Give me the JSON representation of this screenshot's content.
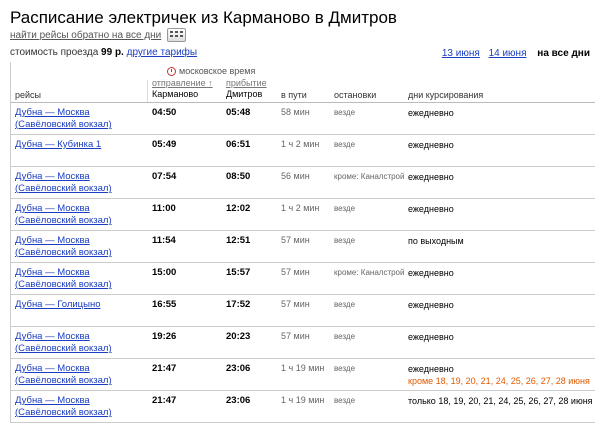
{
  "page": {
    "title": "Расписание электричек из Карманово в Дмитров",
    "reverse_link": "найти рейсы обратно на все дни",
    "price_prefix": "стоимость проезда",
    "price_value": "99 р.",
    "other_tariffs": "другие тарифы"
  },
  "date_nav": {
    "day1": "13 июня",
    "day2": "14 июня",
    "all_days": "на все дни"
  },
  "table": {
    "col_routes": "рейсы",
    "moscow_time": "московское время",
    "dep_label": "отправление ↑",
    "dep_station": "Карманово",
    "arr_label": "прибытие",
    "arr_station": "Дмитров",
    "col_duration": "в пути",
    "col_stops": "остановки",
    "col_days": "дни курсирования"
  },
  "rows": [
    {
      "route": "Дубна — Москва (Савёловский вокзал)",
      "dep": "04:50",
      "arr": "05:48",
      "dur": "58 мин",
      "stops": "везде",
      "days": "ежедневно",
      "exc": ""
    },
    {
      "route": "Дубна — Кубинка 1",
      "dep": "05:49",
      "arr": "06:51",
      "dur": "1 ч 2 мин",
      "stops": "везде",
      "days": "ежедневно",
      "exc": ""
    },
    {
      "route": "Дубна — Москва (Савёловский вокзал)",
      "dep": "07:54",
      "arr": "08:50",
      "dur": "56 мин",
      "stops": "кроме: Каналстрой",
      "days": "ежедневно",
      "exc": ""
    },
    {
      "route": "Дубна — Москва (Савёловский вокзал)",
      "dep": "11:00",
      "arr": "12:02",
      "dur": "1 ч 2 мин",
      "stops": "везде",
      "days": "ежедневно",
      "exc": ""
    },
    {
      "route": "Дубна — Москва (Савёловский вокзал)",
      "dep": "11:54",
      "arr": "12:51",
      "dur": "57 мин",
      "stops": "везде",
      "days": "по выходным",
      "exc": ""
    },
    {
      "route": "Дубна — Москва (Савёловский вокзал)",
      "dep": "15:00",
      "arr": "15:57",
      "dur": "57 мин",
      "stops": "кроме: Каналстрой",
      "days": "ежедневно",
      "exc": ""
    },
    {
      "route": "Дубна — Голицыно",
      "dep": "16:55",
      "arr": "17:52",
      "dur": "57 мин",
      "stops": "везде",
      "days": "ежедневно",
      "exc": ""
    },
    {
      "route": "Дубна — Москва (Савёловский вокзал)",
      "dep": "19:26",
      "arr": "20:23",
      "dur": "57 мин",
      "stops": "везде",
      "days": "ежедневно",
      "exc": ""
    },
    {
      "route": "Дубна — Москва (Савёловский вокзал)",
      "dep": "21:47",
      "arr": "23:06",
      "dur": "1 ч 19 мин",
      "stops": "везде",
      "days": "ежедневно",
      "exc": "кроме 18, 19, 20, 21, 24, 25, 26, 27, 28 июня"
    },
    {
      "route": "Дубна — Москва (Савёловский вокзал)",
      "dep": "21:47",
      "arr": "23:06",
      "dur": "1 ч 19 мин",
      "stops": "везде",
      "days": "только 18, 19, 20, 21, 24, 25, 26, 27, 28 июня",
      "exc": ""
    }
  ],
  "colors": {
    "link": "#1a3dc1",
    "exception": "#e05a00"
  }
}
